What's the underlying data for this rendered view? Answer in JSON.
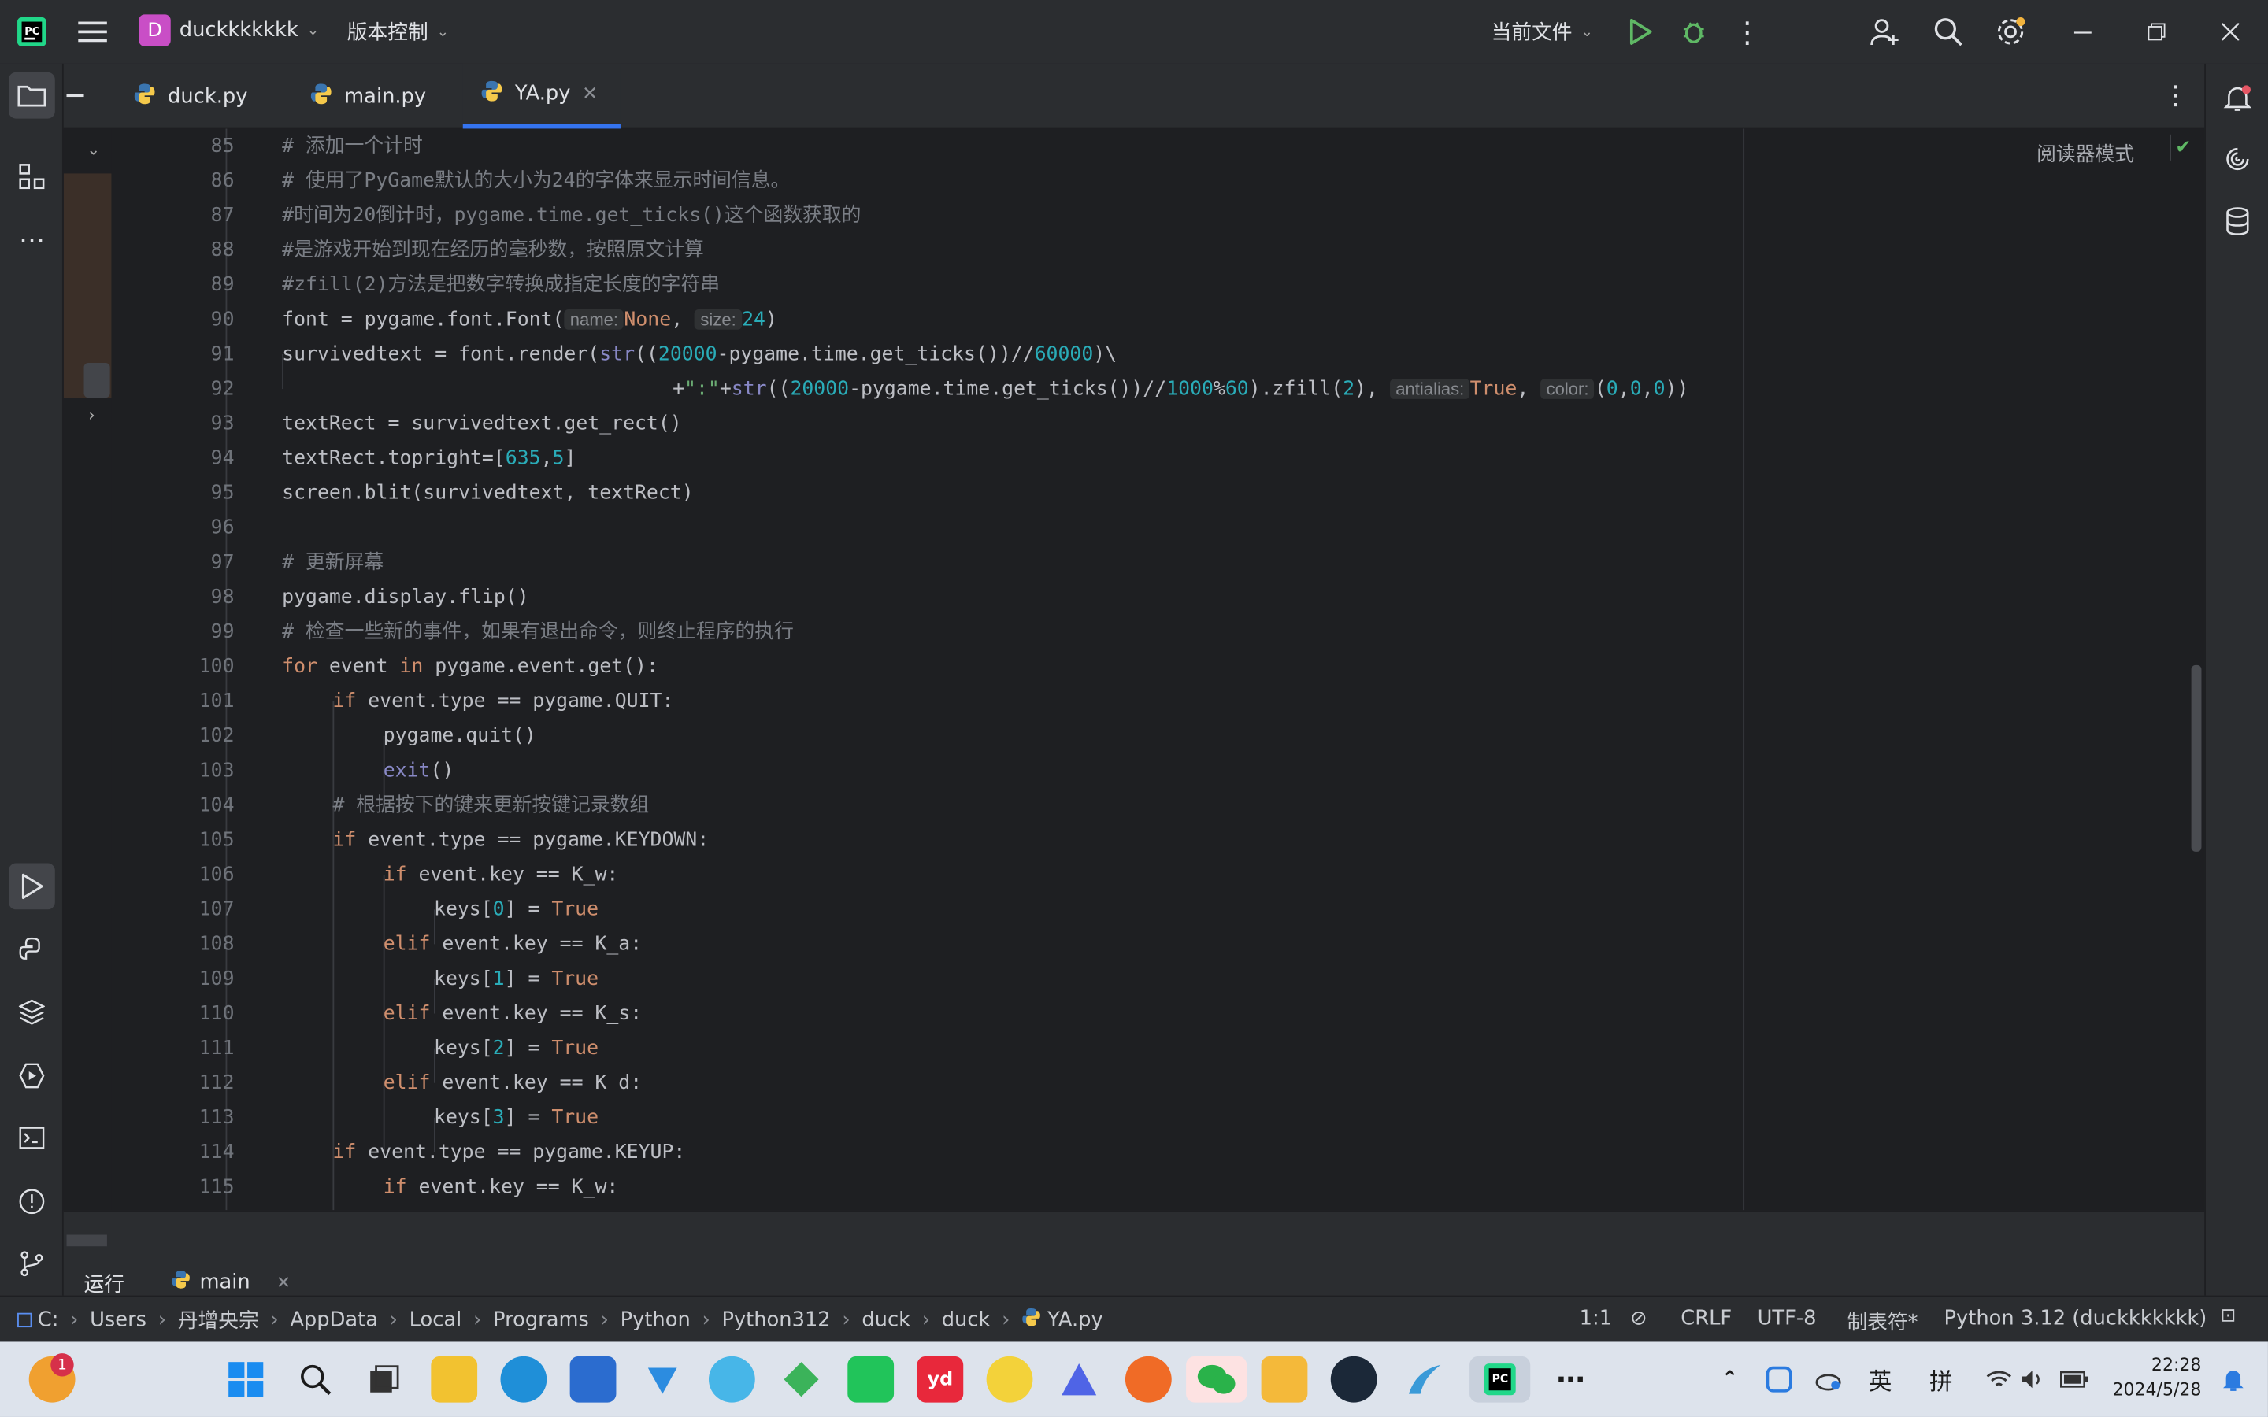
{
  "titlebar": {
    "project_initial": "D",
    "project_name": "duckkkkkkk",
    "vcs_label": "版本控制",
    "run_config": "当前文件"
  },
  "tabs": [
    {
      "label": "duck.py"
    },
    {
      "label": "main.py"
    },
    {
      "label": "YA.py",
      "active": true
    }
  ],
  "editor": {
    "reader_mode": "阅读器模式",
    "lines": [
      {
        "n": "85"
      },
      {
        "n": "86"
      },
      {
        "n": "87"
      },
      {
        "n": "88"
      },
      {
        "n": "89"
      },
      {
        "n": "90"
      },
      {
        "n": "91"
      },
      {
        "n": "92"
      },
      {
        "n": "93"
      },
      {
        "n": "94"
      },
      {
        "n": "95"
      },
      {
        "n": "96"
      },
      {
        "n": "97"
      },
      {
        "n": "98"
      },
      {
        "n": "99"
      },
      {
        "n": "100"
      },
      {
        "n": "101"
      },
      {
        "n": "102"
      },
      {
        "n": "103"
      },
      {
        "n": "104"
      },
      {
        "n": "105"
      },
      {
        "n": "106"
      },
      {
        "n": "107"
      },
      {
        "n": "108"
      },
      {
        "n": "109"
      },
      {
        "n": "110"
      },
      {
        "n": "111"
      },
      {
        "n": "112"
      },
      {
        "n": "113"
      },
      {
        "n": "114"
      },
      {
        "n": "115"
      }
    ],
    "code": {
      "l85": "# 添加一个计时",
      "l86": "# 使用了PyGame默认的大小为24的字体来显示时间信息。",
      "l87": "#时间为20倒计时，pygame.time.get_ticks()这个函数获取的",
      "l88": "#是游戏开始到现在经历的毫秒数，按照原文计算",
      "l89": "#zfill(2)方法是把数字转换成指定长度的字符串",
      "l90a": "font = pygame.font.Font(",
      "l90_hint1": "name:",
      "l90b": "None",
      "l90c": ",",
      "l90_hint2": "size:",
      "l90d": "24",
      "l90e": ")",
      "l91a": "survivedtext = font.render(",
      "l91b": "str",
      "l91c": "((",
      "l91d": "20000",
      "l91e": "-pygame.time.get_ticks())//",
      "l91f": "60000",
      "l91g": ")\\",
      "l92a": "+",
      "l92b": "\":\"",
      "l92c": "+",
      "l92d": "str",
      "l92e": "((",
      "l92f": "20000",
      "l92g": "-pygame.time.get_ticks())//",
      "l92h": "1000",
      "l92i": "%",
      "l92j": "60",
      "l92k": ").zfill(",
      "l92l": "2",
      "l92m": "),",
      "l92_hint1": "antialias:",
      "l92n": "True",
      "l92o": ",",
      "l92_hint2": "color:",
      "l92p": "(",
      "l92q": "0",
      "l92r": ",",
      "l92s": "0",
      "l92t": ",",
      "l92u": "0",
      "l92v": "))",
      "l93": "textRect = survivedtext.get_rect()",
      "l94a": "textRect.topright=[",
      "l94b": "635",
      "l94c": ",",
      "l94d": "5",
      "l94e": "]",
      "l95": "screen.blit(survivedtext, textRect)",
      "l97": "# 更新屏幕",
      "l98": "pygame.display.flip()",
      "l99": "# 检查一些新的事件，如果有退出命令，则终止程序的执行",
      "l100a": "for",
      "l100b": " event ",
      "l100c": "in",
      "l100d": " pygame.event.get():",
      "l101a": "if",
      "l101b": " event.type == pygame.QUIT:",
      "l102": "pygame.quit()",
      "l103a": "exit",
      "l103b": "()",
      "l104": "# 根据按下的键来更新按键记录数组",
      "l105a": "if",
      "l105b": " event.type == pygame.KEYDOWN:",
      "l106a": "if",
      "l106b": " event.key == K_w:",
      "l107a": "keys[",
      "l107b": "0",
      "l107c": "] = ",
      "l107d": "True",
      "l108a": "elif",
      "l108b": " event.key == K_a:",
      "l109a": "keys[",
      "l109b": "1",
      "l109c": "] = ",
      "l109d": "True",
      "l110a": "elif",
      "l110b": " event.key == K_s:",
      "l111a": "keys[",
      "l111b": "2",
      "l111c": "] = ",
      "l111d": "True",
      "l112a": "elif",
      "l112b": " event.key == K_d:",
      "l113a": "keys[",
      "l113b": "3",
      "l113c": "] = ",
      "l113d": "True",
      "l114a": "if",
      "l114b": " event.type == pygame.KEYUP:",
      "l115a": "if",
      "l115b": " event.key == K_w:"
    }
  },
  "bottom_panel": {
    "run_label": "运行",
    "run_tab": "main"
  },
  "statusbar": {
    "breadcrumbs": [
      "C:",
      "Users",
      "丹增央宗",
      "AppData",
      "Local",
      "Programs",
      "Python",
      "Python312",
      "duck",
      "duck",
      "YA.py"
    ],
    "position": "1:1",
    "line_ending": "CRLF",
    "encoding": "UTF-8",
    "indent": "制表符*",
    "interpreter": "Python 3.12 (duckkkkkkk)"
  },
  "taskbar": {
    "badge": "1",
    "ime_lang": "英",
    "ime_mode": "拼",
    "time": "22:28",
    "date": "2024/5/28"
  }
}
